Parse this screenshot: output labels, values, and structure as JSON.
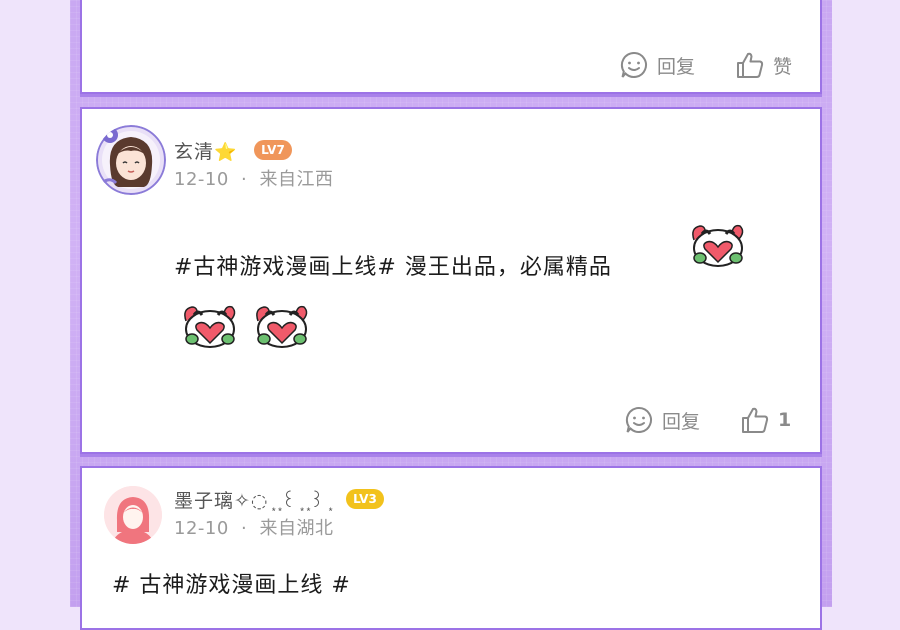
{
  "top_post": {
    "reply_label": "回复",
    "like_label": "赞"
  },
  "main_post": {
    "username": "玄清",
    "name_badge": "⭐",
    "level": "LV7",
    "date": "12-10",
    "separator": "·",
    "location": "来自江西",
    "content": "#古神游戏漫画上线# 漫王出品，必属精品",
    "stickers": [
      "heart-panda-sticker",
      "heart-panda-sticker",
      "heart-panda-sticker"
    ],
    "reply_label": "回复",
    "like_count": "1"
  },
  "third_post": {
    "username": "墨子璃✧◌ ͙ ͙꒰ ͙ ͙꒱ ͙",
    "level": "LV3",
    "date": "12-10",
    "separator": "·",
    "location": "来自湖北",
    "content": "# 古神游戏漫画上线 #"
  },
  "colors": {
    "page_bg": "#efe4fb",
    "column_bg": "#c8a6f2",
    "card_border": "#9c73e6",
    "level7_badge": "#f0965a",
    "level3_badge": "#f2c21c",
    "meta_text": "#9a9a9a"
  }
}
